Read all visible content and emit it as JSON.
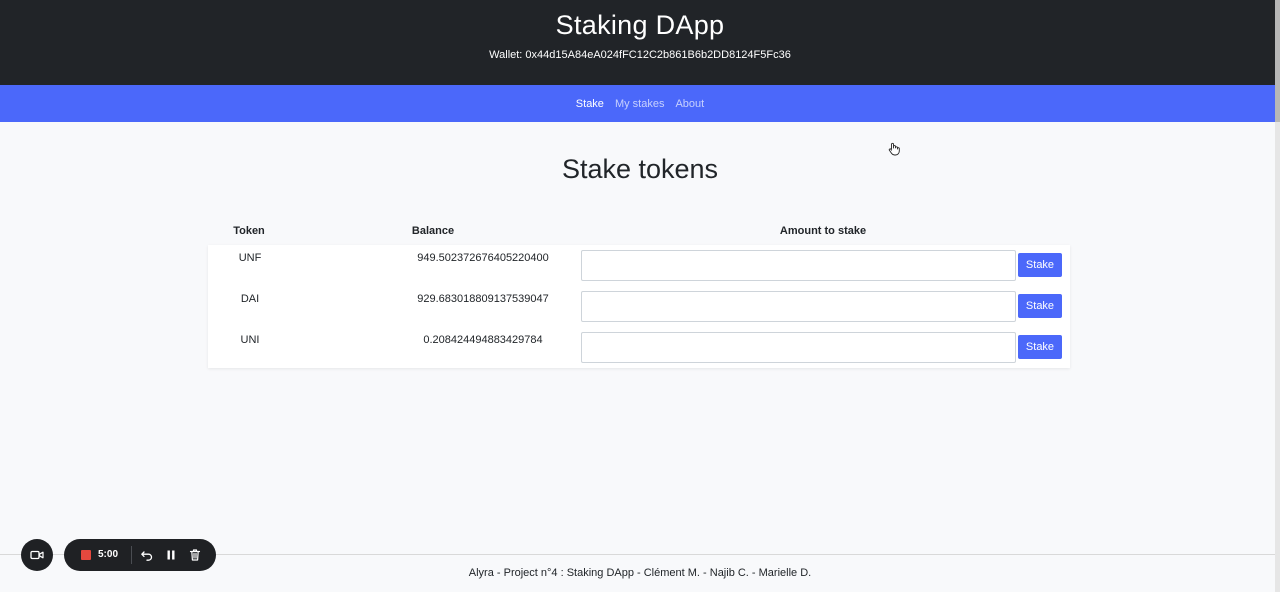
{
  "header": {
    "title": "Staking DApp",
    "wallet": "Wallet: 0x44d15A84eA024fFC12C2b861B6b2DD8124F5Fc36"
  },
  "nav": {
    "items": [
      {
        "label": "Stake",
        "active": true
      },
      {
        "label": "My stakes",
        "active": false
      },
      {
        "label": "About",
        "active": false
      }
    ]
  },
  "main": {
    "heading": "Stake tokens",
    "columns": {
      "token": "Token",
      "balance": "Balance",
      "amount": "Amount to stake"
    },
    "rows": [
      {
        "token": "UNF",
        "balance": "949.502372676405220400",
        "amount": "",
        "button": "Stake"
      },
      {
        "token": "DAI",
        "balance": "929.683018809137539047",
        "amount": "",
        "button": "Stake"
      },
      {
        "token": "UNI",
        "balance": "0.208424494883429784",
        "amount": "",
        "button": "Stake"
      }
    ]
  },
  "footer": {
    "text": "Alyra - Project n°4 : Staking DApp - Clément M. - Najib C. - Marielle D."
  },
  "recorder": {
    "time": "5:00",
    "icons": [
      "camera-icon",
      "stop-icon",
      "undo-icon",
      "pause-icon",
      "trash-icon"
    ]
  },
  "colors": {
    "header_bg": "#212428",
    "accent": "#4b68fa",
    "page_bg": "#f8f9fb",
    "record_red": "#e5483e"
  }
}
